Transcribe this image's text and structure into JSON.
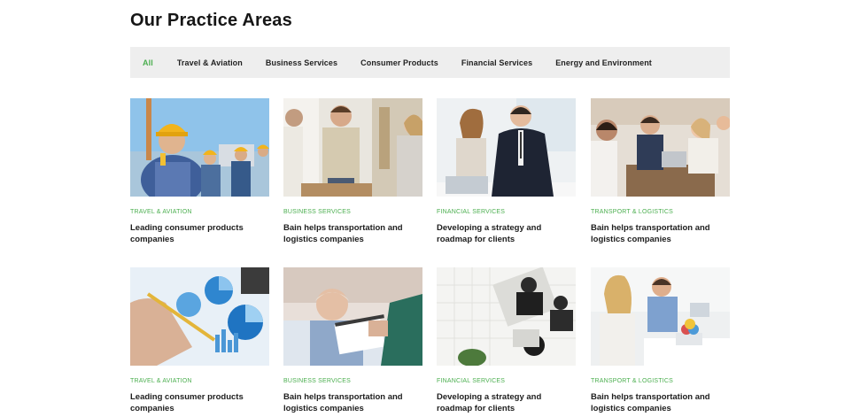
{
  "page": {
    "title": "Our Practice Areas"
  },
  "filters": [
    {
      "label": "All",
      "active": true
    },
    {
      "label": "Travel & Aviation",
      "active": false
    },
    {
      "label": "Business Services",
      "active": false
    },
    {
      "label": "Consumer Products",
      "active": false
    },
    {
      "label": "Financial Services",
      "active": false
    },
    {
      "label": "Energy and Environment",
      "active": false
    }
  ],
  "cards": [
    {
      "category": "TRAVEL & AVIATION",
      "title": "Leading consumer products companies",
      "image": "construction-workers-thumbs-up"
    },
    {
      "category": "BUSINESS SERVICES",
      "title": "Bain helps transportation and logistics companies",
      "image": "office-colleagues-laughing"
    },
    {
      "category": "FINANCIAL SERVICES",
      "title": "Developing a strategy and roadmap for clients",
      "image": "business-meeting-laptop"
    },
    {
      "category": "TRANSPORT & LOGISTICS",
      "title": "Bain helps transportation and logistics companies",
      "image": "team-meeting-table"
    },
    {
      "category": "TRAVEL & AVIATION",
      "title": "Leading consumer products companies",
      "image": "financial-charts-pencil"
    },
    {
      "category": "BUSINESS SERVICES",
      "title": "Bain helps transportation and logistics companies",
      "image": "doctor-patient-clipboard"
    },
    {
      "category": "FINANCIAL SERVICES",
      "title": "Developing a strategy and roadmap for clients",
      "image": "office-overhead-view"
    },
    {
      "category": "TRANSPORT & LOGISTICS",
      "title": "Bain helps transportation and logistics companies",
      "image": "coworkers-desk-laptop"
    }
  ],
  "colors": {
    "accent": "#4caf50",
    "filter_bg": "#eeeeee"
  }
}
